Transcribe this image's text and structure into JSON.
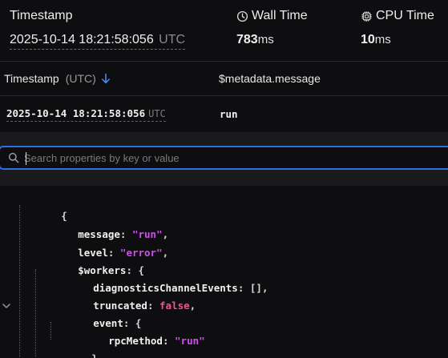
{
  "summary": {
    "timestamp_label": "Timestamp",
    "timestamp_value": "2025-10-14 18:21:58:056",
    "timestamp_tz": "UTC",
    "wall_time_label": "Wall Time",
    "wall_time_value": "783",
    "wall_time_unit": "ms",
    "cpu_time_label": "CPU Time",
    "cpu_time_value": "10",
    "cpu_time_unit": "ms",
    "icons": {
      "wall": "clock-icon",
      "cpu": "cpu-chip-icon"
    }
  },
  "table": {
    "columns": {
      "timestamp": "Timestamp",
      "timestamp_tz": "(UTC)",
      "message": "$metadata.message"
    },
    "sort_icon": "arrow-down-icon",
    "row": {
      "timestamp": "2025-10-14 18:21:58:056",
      "tz": "UTC",
      "message": "run"
    }
  },
  "search": {
    "placeholder": "Search properties by key or value",
    "value": ""
  },
  "json_view": {
    "open_brace": "{",
    "lines": [
      {
        "key": "message",
        "value": "\"run\"",
        "type": "string"
      },
      {
        "key": "level",
        "value": "\"error\"",
        "type": "string"
      },
      {
        "key": "$workers",
        "value": "{",
        "type": "open"
      },
      {
        "key": "diagnosticsChannelEvents",
        "value": "[],",
        "type": "array"
      },
      {
        "key": "truncated",
        "value": "false",
        "type": "bool"
      },
      {
        "key": "event",
        "value": "{",
        "type": "open"
      },
      {
        "key": "rpcMethod",
        "value": "\"run\"",
        "type": "string"
      },
      {
        "close": "},"
      }
    ]
  },
  "colors": {
    "accent": "#2f6fe0",
    "string": "#d24cf0",
    "boolean": "#f0548b",
    "background": "#0e0e10",
    "panel": "#1a1a1c"
  }
}
